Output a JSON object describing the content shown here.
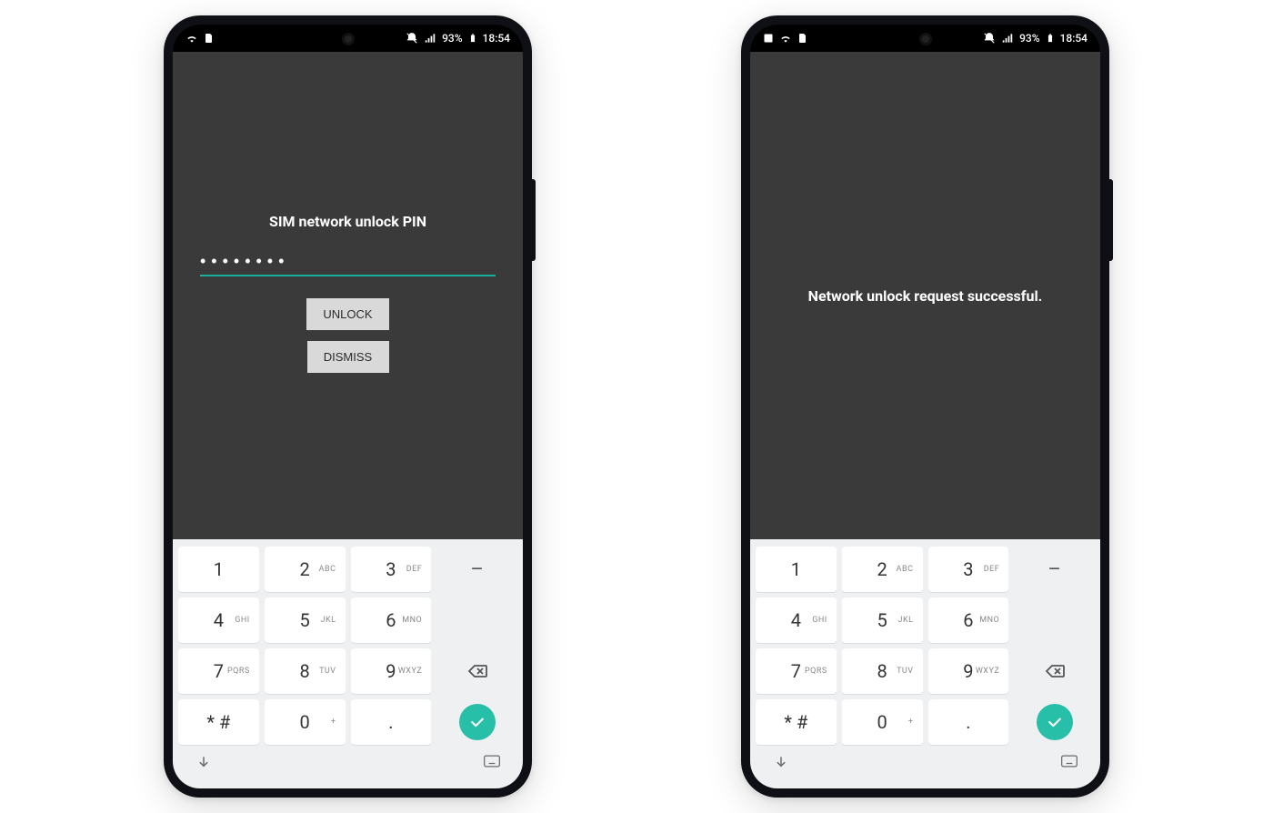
{
  "status": {
    "battery": "93%",
    "time": "18:54"
  },
  "phone_left": {
    "title": "SIM network unlock PIN",
    "pin_mask": "••••••••",
    "unlock_label": "UNLOCK",
    "dismiss_label": "DISMISS"
  },
  "phone_right": {
    "message": "Network unlock request successful."
  },
  "keyboard": {
    "rows": [
      [
        {
          "num": "1",
          "letters": ""
        },
        {
          "num": "2",
          "letters": "ABC"
        },
        {
          "num": "3",
          "letters": "DEF"
        },
        {
          "sym": "–"
        }
      ],
      [
        {
          "num": "4",
          "letters": "GHI"
        },
        {
          "num": "5",
          "letters": "JKL"
        },
        {
          "num": "6",
          "letters": "MNO"
        },
        {
          "sym": ""
        }
      ],
      [
        {
          "num": "7",
          "letters": "PQRS"
        },
        {
          "num": "8",
          "letters": "TUV"
        },
        {
          "num": "9",
          "letters": "WXYZ"
        },
        {
          "action": "backspace"
        }
      ],
      [
        {
          "num": "* #",
          "letters": ""
        },
        {
          "num": "0",
          "letters": "+"
        },
        {
          "num": ".",
          "letters": ""
        },
        {
          "action": "submit"
        }
      ]
    ]
  }
}
